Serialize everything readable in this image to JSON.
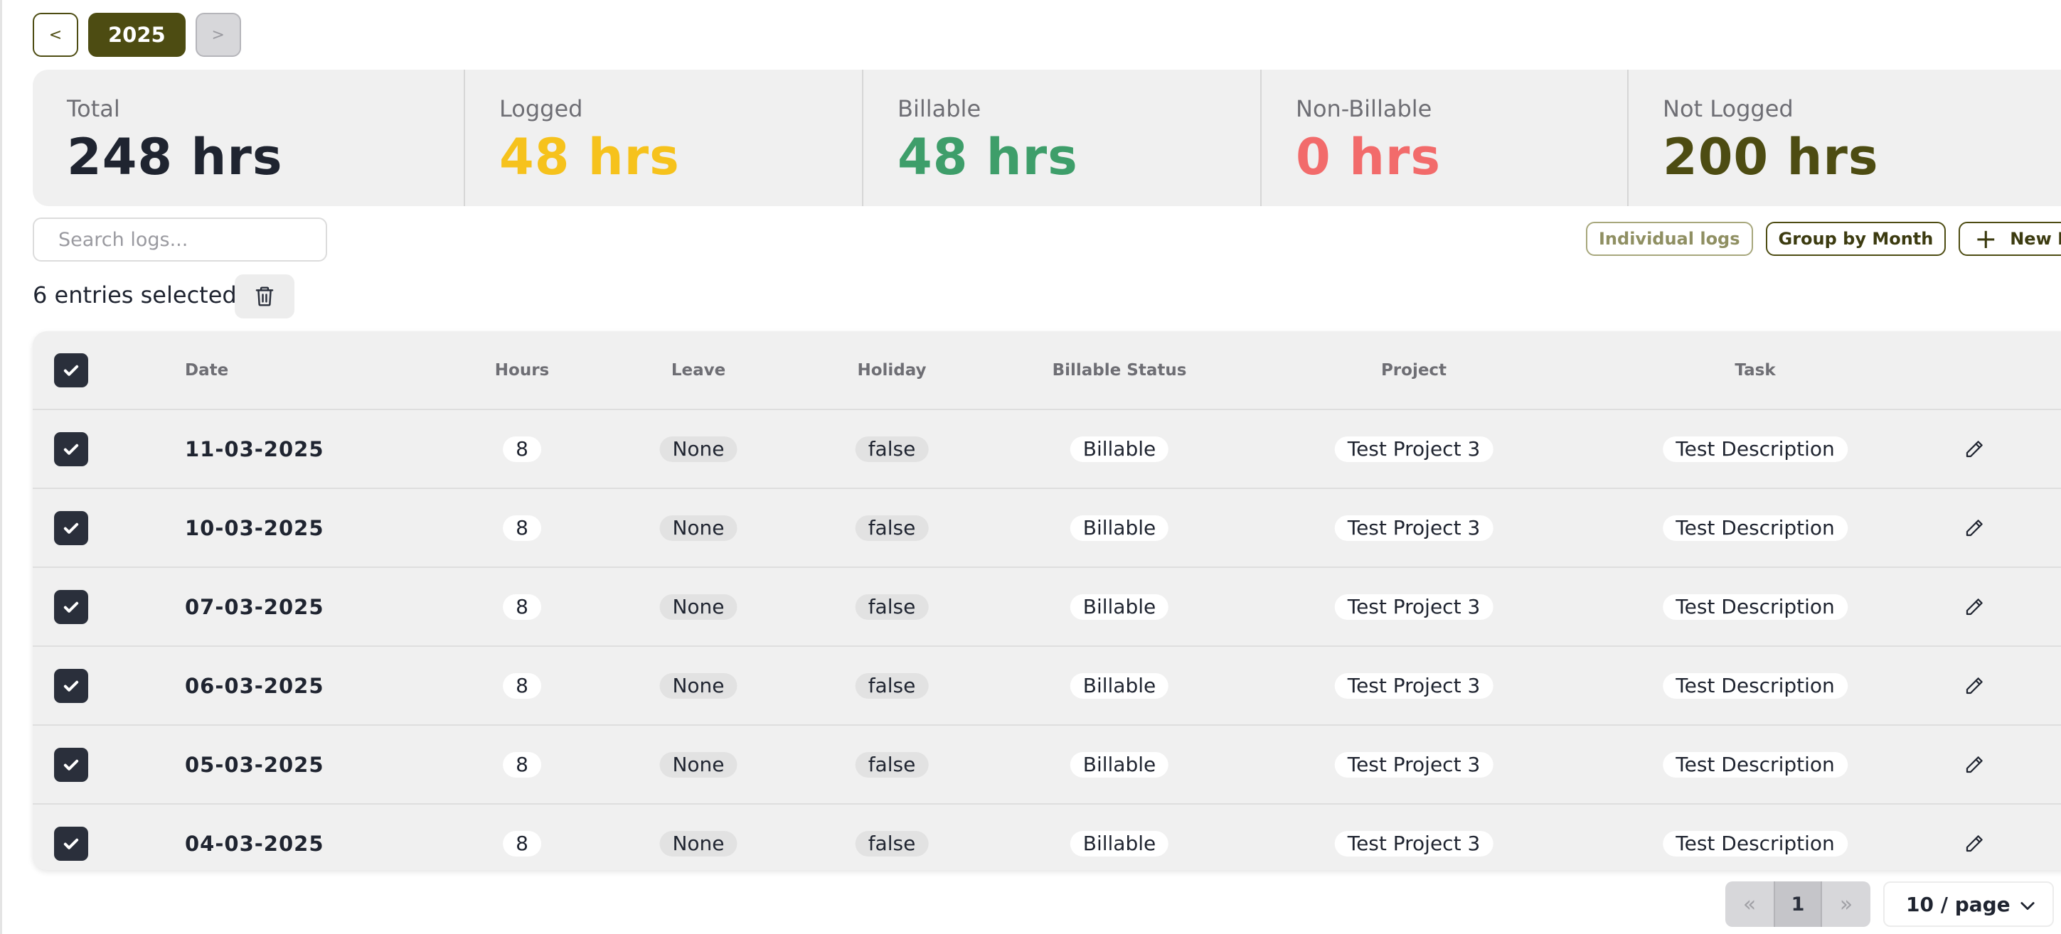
{
  "year_nav": {
    "prev_label": "<",
    "year": "2025",
    "next_label": ">"
  },
  "stats": [
    {
      "label": "Total",
      "value": "248 hrs",
      "color": "#1f2430"
    },
    {
      "label": "Logged",
      "value": "48 hrs",
      "color": "#f6c21c"
    },
    {
      "label": "Billable",
      "value": "48 hrs",
      "color": "#3e9e6a"
    },
    {
      "label": "Non-Billable",
      "value": "0 hrs",
      "color": "#f26b6b"
    },
    {
      "label": "Not Logged",
      "value": "200 hrs",
      "color": "#4d4c12"
    }
  ],
  "search": {
    "placeholder": "Search logs...",
    "value": ""
  },
  "toolbar": {
    "individual_label": "Individual logs",
    "group_label": "Group by Month",
    "new_label": "New Logs",
    "plus_icon": "+"
  },
  "selection": {
    "text": "6 entries selected",
    "delete_icon": "trash-icon"
  },
  "table": {
    "columns": [
      "Date",
      "Hours",
      "Leave",
      "Holiday",
      "Billable Status",
      "Project",
      "Task"
    ],
    "rows": [
      {
        "date": "11-03-2025",
        "hours": "8",
        "leave": "None",
        "holiday": "false",
        "billable": "Billable",
        "project": "Test Project 3",
        "task": "Test Description",
        "checked": true
      },
      {
        "date": "10-03-2025",
        "hours": "8",
        "leave": "None",
        "holiday": "false",
        "billable": "Billable",
        "project": "Test Project 3",
        "task": "Test Description",
        "checked": true
      },
      {
        "date": "07-03-2025",
        "hours": "8",
        "leave": "None",
        "holiday": "false",
        "billable": "Billable",
        "project": "Test Project 3",
        "task": "Test Description",
        "checked": true
      },
      {
        "date": "06-03-2025",
        "hours": "8",
        "leave": "None",
        "holiday": "false",
        "billable": "Billable",
        "project": "Test Project 3",
        "task": "Test Description",
        "checked": true
      },
      {
        "date": "05-03-2025",
        "hours": "8",
        "leave": "None",
        "holiday": "false",
        "billable": "Billable",
        "project": "Test Project 3",
        "task": "Test Description",
        "checked": true
      },
      {
        "date": "04-03-2025",
        "hours": "8",
        "leave": "None",
        "holiday": "false",
        "billable": "Billable",
        "project": "Test Project 3",
        "task": "Test Description",
        "checked": true
      }
    ]
  },
  "pagination": {
    "first_label": "«",
    "current_page": "1",
    "last_label": "»",
    "page_size": "10 / page"
  },
  "colors": {
    "brand": "#4d4c12",
    "panel": "#f0f0f0",
    "check": "#2a2f3b"
  }
}
